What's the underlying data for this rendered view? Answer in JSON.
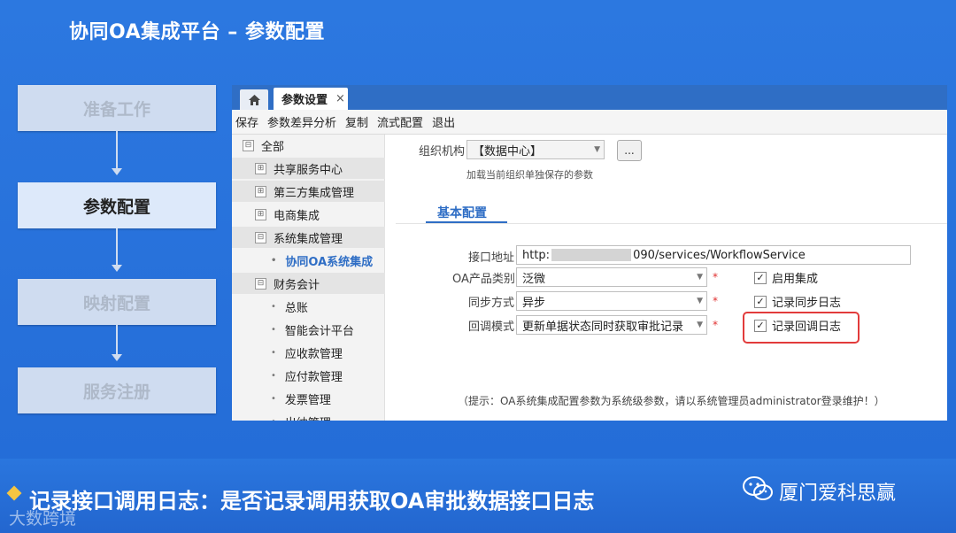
{
  "slide": {
    "title": "协同OA集成平台 – 参数配置",
    "steps": [
      {
        "label": "准备工作"
      },
      {
        "label": "参数配置"
      },
      {
        "label": "映射配置"
      },
      {
        "label": "服务注册"
      }
    ]
  },
  "window": {
    "tab_label": "参数设置",
    "tab_close": "×",
    "home_icon": "home-icon",
    "toolbar": [
      "保存",
      "参数差异分析",
      "复制",
      "流式配置",
      "退出"
    ],
    "tree": [
      {
        "toggle": "⊟",
        "label": "全部"
      },
      {
        "toggle": "⊞",
        "label": "共享服务中心"
      },
      {
        "toggle": "⊞",
        "label": "第三方集成管理"
      },
      {
        "toggle": "⊞",
        "label": "电商集成"
      },
      {
        "toggle": "⊟",
        "label": "系统集成管理"
      },
      {
        "toggle": "•",
        "label": "协同OA系统集成"
      },
      {
        "toggle": "⊟",
        "label": "财务会计"
      },
      {
        "toggle": "•",
        "label": "总账"
      },
      {
        "toggle": "•",
        "label": "智能会计平台"
      },
      {
        "toggle": "•",
        "label": "应收款管理"
      },
      {
        "toggle": "•",
        "label": "应付款管理"
      },
      {
        "toggle": "•",
        "label": "发票管理"
      },
      {
        "toggle": "•",
        "label": "出纳管理"
      }
    ],
    "org": {
      "label": "组织机构",
      "value": "【数据中心】",
      "button": "...",
      "hint": "加载当前组织单独保存的参数"
    },
    "section_tab": "基本配置",
    "fields": {
      "endpoint": {
        "label": "接口地址",
        "prefix": "http:",
        "suffix": "090/services/WorkflowService"
      },
      "oa_type": {
        "label": "OA产品类别",
        "value": "泛微",
        "required": "*"
      },
      "sync_mode": {
        "label": "同步方式",
        "value": "异步",
        "required": "*"
      },
      "callback_mode": {
        "label": "回调模式",
        "value": "更新单据状态同时获取审批记录",
        "required": "*"
      }
    },
    "checkboxes": [
      {
        "label": "启用集成",
        "checked": true
      },
      {
        "label": "记录同步日志",
        "checked": true
      },
      {
        "label": "记录回调日志",
        "checked": true
      }
    ],
    "note": "（提示：OA系统集成配置参数为系统级参数，请以系统管理员administrator登录维护！）"
  },
  "footer": {
    "caption": "记录接口调用日志：是否记录调用获取OA审批数据接口日志",
    "brand": "厦门爱科思赢",
    "watermark": "大数跨境"
  }
}
